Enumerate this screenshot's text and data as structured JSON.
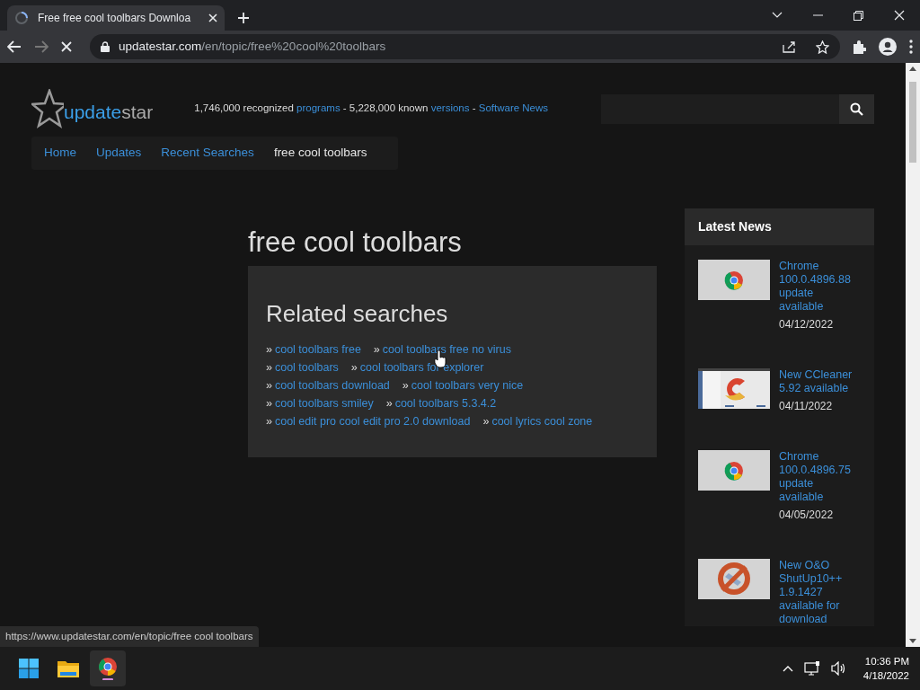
{
  "browser": {
    "tab_title": "Free free cool toolbars Downloa",
    "url_host": "updatestar.com",
    "url_path": "/en/topic/free%20cool%20toolbars",
    "loading": true
  },
  "header": {
    "logo": {
      "part1": "update",
      "part2": "star"
    },
    "stats": [
      {
        "kind": "text",
        "text": "1,746,000 recognized "
      },
      {
        "kind": "link",
        "text": "programs"
      },
      {
        "kind": "text",
        "text": " - 5,228,000 known "
      },
      {
        "kind": "link",
        "text": "versions"
      },
      {
        "kind": "text",
        "text": " - "
      },
      {
        "kind": "link",
        "text": "Software News"
      }
    ]
  },
  "nav": [
    {
      "label": "Home",
      "selected": false
    },
    {
      "label": "Updates",
      "selected": false
    },
    {
      "label": "Recent Searches",
      "selected": false
    },
    {
      "label": "free cool toolbars",
      "selected": true
    }
  ],
  "page_title": "free cool toolbars",
  "related": {
    "title": "Related searches",
    "rows": [
      [
        "cool toolbars free",
        "cool toolbars free no virus"
      ],
      [
        "cool toolbars",
        "cool toolbars for explorer"
      ],
      [
        "cool toolbars download",
        "cool toolbars very nice"
      ],
      [
        "cool toolbars smiley",
        "cool toolbars 5.3.4.2"
      ],
      [
        "cool edit pro cool edit pro 2.0 download",
        "cool lyrics cool zone"
      ]
    ],
    "bullet": "»"
  },
  "news": {
    "title": "Latest News",
    "items": [
      {
        "kind": "chrome",
        "title": "Chrome 100.0.4896.88 update available",
        "date": "04/12/2022"
      },
      {
        "kind": "ccleaner",
        "title": "New CCleaner 5.92 available",
        "date": "04/11/2022"
      },
      {
        "kind": "chrome",
        "title": "Chrome 100.0.4896.75 update available",
        "date": "04/05/2022"
      },
      {
        "kind": "shutup",
        "title": "New O&O ShutUp10++ 1.9.1427 available for download"
      }
    ]
  },
  "status_url": "https://www.updatestar.com/en/topic/free cool toolbars",
  "taskbar": {
    "time": "10:36 PM",
    "date": "4/18/2022"
  }
}
